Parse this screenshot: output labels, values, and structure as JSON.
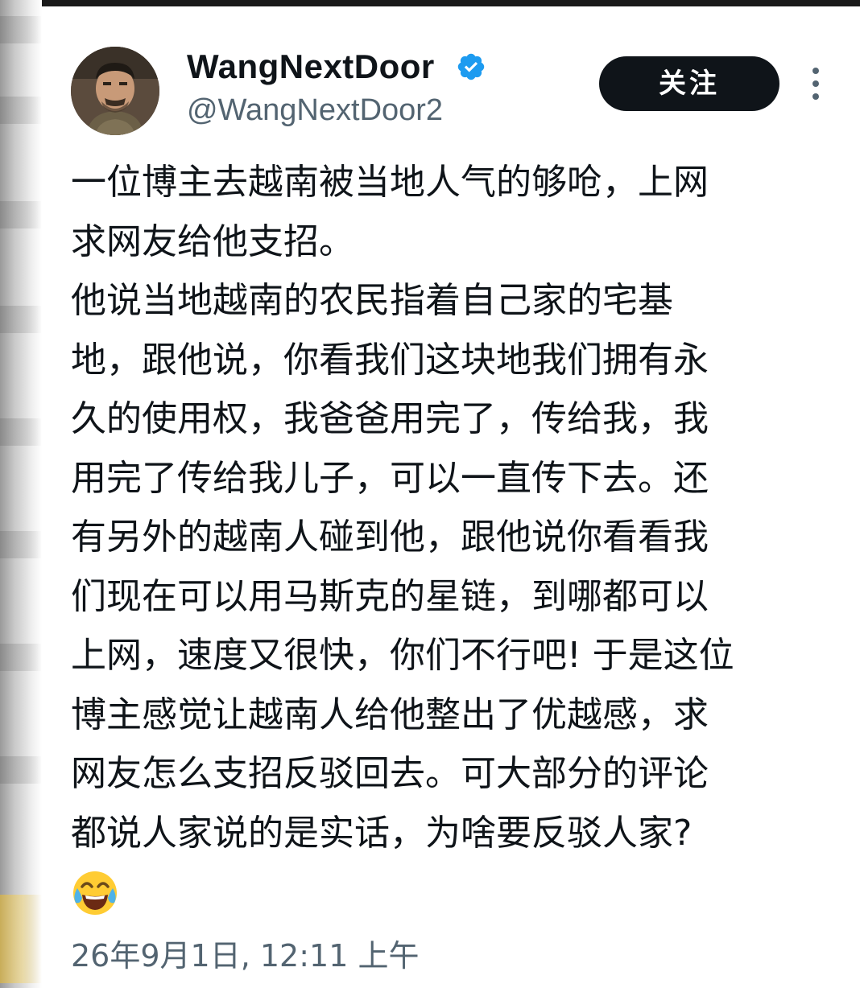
{
  "author": {
    "display_name": "WangNextDoor",
    "handle": "@WangNextDoor2",
    "verified_icon": "verified-badge-icon",
    "avatar": "profile-photo"
  },
  "actions": {
    "follow_label": "关注",
    "more_icon": "more-vertical-icon"
  },
  "tweet": {
    "lines": [
      "一位博主去越南被当地人气的够呛，上网",
      "求网友给他支招。",
      "他说当地越南的农民指着自己家的宅基",
      "地，跟他说，你看我们这块地我们拥有永",
      "久的使用权，我爸爸用完了，传给我，我",
      "用完了传给我儿子，可以一直传下去。还",
      "有另外的越南人碰到他，跟他说你看看我",
      "们现在可以用马斯克的星链，到哪都可以",
      "上网，速度又很快，你们不行吧! 于是这位",
      "博主感觉让越南人给他整出了优越感，求",
      "网友怎么支招反驳回去。可大部分的评论",
      "都说人家说的是实话，为啥要反驳人家?"
    ],
    "emoji": "face-with-tears-of-joy"
  },
  "timestamp": "26年9月1日, 12:11 上午",
  "colors": {
    "text_primary": "#0f1419",
    "text_secondary": "#536471",
    "verified_blue": "#1d9bf0",
    "follow_button_bg": "#0f1419"
  }
}
